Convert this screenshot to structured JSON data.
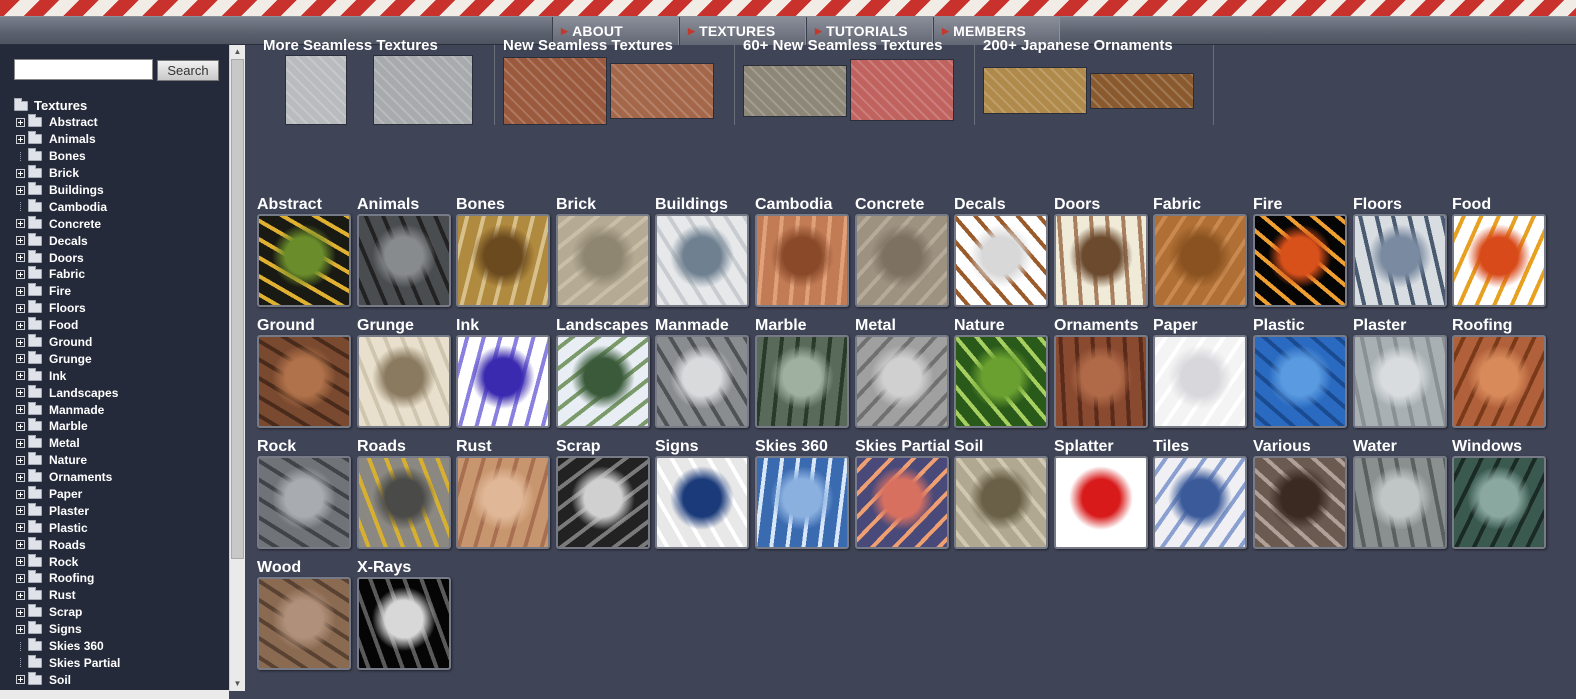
{
  "nav": {
    "items": [
      "ABOUT",
      "TEXTURES",
      "TUTORIALS",
      "MEMBERS"
    ]
  },
  "sidebar": {
    "search_placeholder": "",
    "search_button": "Search",
    "root_label": "Textures",
    "items": [
      {
        "label": "Abstract",
        "expandable": true
      },
      {
        "label": "Animals",
        "expandable": true
      },
      {
        "label": "Bones",
        "expandable": false
      },
      {
        "label": "Brick",
        "expandable": true
      },
      {
        "label": "Buildings",
        "expandable": true
      },
      {
        "label": "Cambodia",
        "expandable": false
      },
      {
        "label": "Concrete",
        "expandable": true
      },
      {
        "label": "Decals",
        "expandable": true
      },
      {
        "label": "Doors",
        "expandable": true
      },
      {
        "label": "Fabric",
        "expandable": true
      },
      {
        "label": "Fire",
        "expandable": true
      },
      {
        "label": "Floors",
        "expandable": true
      },
      {
        "label": "Food",
        "expandable": true
      },
      {
        "label": "Ground",
        "expandable": true
      },
      {
        "label": "Grunge",
        "expandable": true
      },
      {
        "label": "Ink",
        "expandable": true
      },
      {
        "label": "Landscapes",
        "expandable": true
      },
      {
        "label": "Manmade",
        "expandable": true
      },
      {
        "label": "Marble",
        "expandable": true
      },
      {
        "label": "Metal",
        "expandable": true
      },
      {
        "label": "Nature",
        "expandable": true
      },
      {
        "label": "Ornaments",
        "expandable": true
      },
      {
        "label": "Paper",
        "expandable": true
      },
      {
        "label": "Plaster",
        "expandable": true
      },
      {
        "label": "Plastic",
        "expandable": true
      },
      {
        "label": "Roads",
        "expandable": true
      },
      {
        "label": "Rock",
        "expandable": true
      },
      {
        "label": "Roofing",
        "expandable": true
      },
      {
        "label": "Rust",
        "expandable": true
      },
      {
        "label": "Scrap",
        "expandable": true
      },
      {
        "label": "Signs",
        "expandable": true
      },
      {
        "label": "Skies 360",
        "expandable": false
      },
      {
        "label": "Skies Partial",
        "expandable": false
      },
      {
        "label": "Soil",
        "expandable": true
      }
    ]
  },
  "featured": [
    {
      "title": "More Seamless Textures",
      "colors": [
        "#b9bcbf",
        "#a8abae"
      ]
    },
    {
      "title": "New Seamless Textures",
      "colors": [
        "#9b5a3e",
        "#a4674a"
      ]
    },
    {
      "title": "60+ New Seamless Textures",
      "colors": [
        "#8d8778",
        "#c0625e"
      ]
    },
    {
      "title": "200+ Japanese Ornaments",
      "colors": [
        "#b08a4a",
        "#8a5a2e"
      ]
    }
  ],
  "categories": [
    {
      "label": "Abstract",
      "colors": [
        "#1a1a14",
        "#6a8c2a",
        "#e0b030"
      ]
    },
    {
      "label": "Animals",
      "colors": [
        "#4a4d50",
        "#888b8e",
        "#222"
      ]
    },
    {
      "label": "Bones",
      "colors": [
        "#b08a3e",
        "#6b4a1f",
        "#d8c08a"
      ]
    },
    {
      "label": "Brick",
      "colors": [
        "#b5ab95",
        "#8f8672",
        "#c9bfa8"
      ]
    },
    {
      "label": "Buildings",
      "colors": [
        "#e6e8ea",
        "#6f8090",
        "#c8ccd0"
      ]
    },
    {
      "label": "Cambodia",
      "colors": [
        "#c27c55",
        "#8a4a2a",
        "#e0a07a"
      ]
    },
    {
      "label": "Concrete",
      "colors": [
        "#9d9280",
        "#7d7262",
        "#b5aa98"
      ]
    },
    {
      "label": "Decals",
      "colors": [
        "#ffffff",
        "#d8d8d8",
        "#9a5a2a"
      ]
    },
    {
      "label": "Doors",
      "colors": [
        "#f0ead8",
        "#6b4a2e",
        "#a88060"
      ]
    },
    {
      "label": "Fabric",
      "colors": [
        "#b07035",
        "#8a5220",
        "#c88a50"
      ]
    },
    {
      "label": "Fire",
      "colors": [
        "#050505",
        "#d8501a",
        "#f0a030"
      ]
    },
    {
      "label": "Floors",
      "colors": [
        "#d8dde2",
        "#7a8aa0",
        "#4a5a70"
      ]
    },
    {
      "label": "Food",
      "colors": [
        "#ffffff",
        "#d84a1a",
        "#e8a020"
      ]
    },
    {
      "label": "Ground",
      "colors": [
        "#7a4a30",
        "#b0724a",
        "#4a2a1a"
      ]
    },
    {
      "label": "Grunge",
      "colors": [
        "#e8e0cc",
        "#8a7a60",
        "#d0c6b0"
      ]
    },
    {
      "label": "Ink",
      "colors": [
        "#ffffff",
        "#3a2ab0",
        "#8a80e0"
      ]
    },
    {
      "label": "Landscapes",
      "colors": [
        "#e8eef4",
        "#3a5a3a",
        "#7a9a6a"
      ]
    },
    {
      "label": "Manmade",
      "colors": [
        "#8a8d90",
        "#d8dadc",
        "#505355"
      ]
    },
    {
      "label": "Marble",
      "colors": [
        "#5a6a5a",
        "#a0b0a0",
        "#2a3a2a"
      ]
    },
    {
      "label": "Metal",
      "colors": [
        "#a0a0a0",
        "#d0d0d0",
        "#707070"
      ]
    },
    {
      "label": "Nature",
      "colors": [
        "#2a5a1a",
        "#6aa030",
        "#a8d060"
      ]
    },
    {
      "label": "Ornaments",
      "colors": [
        "#8a4a30",
        "#b06a48",
        "#5a2a1a"
      ]
    },
    {
      "label": "Paper",
      "colors": [
        "#f4f4f4",
        "#d8d8dc",
        "#ffffff"
      ]
    },
    {
      "label": "Plastic",
      "colors": [
        "#2a6ac0",
        "#5a9ae0",
        "#1a4a90"
      ]
    },
    {
      "label": "Plaster",
      "colors": [
        "#a8b0b4",
        "#d8dcde",
        "#8a9094"
      ]
    },
    {
      "label": "Roofing",
      "colors": [
        "#b0603a",
        "#d88a5a",
        "#7a3a1a"
      ]
    },
    {
      "label": "Rock",
      "colors": [
        "#707478",
        "#a8acb0",
        "#404448"
      ]
    },
    {
      "label": "Roads",
      "colors": [
        "#8a8880",
        "#4a4a48",
        "#d8b030"
      ]
    },
    {
      "label": "Rust",
      "colors": [
        "#c8966e",
        "#e0b898",
        "#a87050"
      ]
    },
    {
      "label": "Scrap",
      "colors": [
        "#222",
        "#d0d0d0",
        "#7a7a7a"
      ]
    },
    {
      "label": "Signs",
      "colors": [
        "#e8e8e8",
        "#1a3a7a",
        "#ffffff"
      ]
    },
    {
      "label": "Skies 360",
      "colors": [
        "#3a6ab0",
        "#8ab0e0",
        "#d8e8f8"
      ]
    },
    {
      "label": "Skies Partial",
      "colors": [
        "#4a4a7a",
        "#d87060",
        "#f0a070"
      ]
    },
    {
      "label": "Soil",
      "colors": [
        "#b0a890",
        "#6a6048",
        "#d0c8b0"
      ]
    },
    {
      "label": "Splatter",
      "colors": [
        "#ffffff",
        "#d81a1a",
        "#ffffff"
      ]
    },
    {
      "label": "Tiles",
      "colors": [
        "#f0f0f4",
        "#3a5a9a",
        "#8aa0d0"
      ]
    },
    {
      "label": "Various",
      "colors": [
        "#6a5a50",
        "#3a2a22",
        "#b0a098"
      ]
    },
    {
      "label": "Water",
      "colors": [
        "#8a9090",
        "#c0c6c6",
        "#5a6060"
      ]
    },
    {
      "label": "Windows",
      "colors": [
        "#3a5a50",
        "#8aa8a0",
        "#1a2a24"
      ]
    },
    {
      "label": "Wood",
      "colors": [
        "#8a6a50",
        "#b0907a",
        "#5a4232"
      ]
    },
    {
      "label": "X-Rays",
      "colors": [
        "#050505",
        "#d8d8d8",
        "#5a5a5a"
      ]
    }
  ]
}
